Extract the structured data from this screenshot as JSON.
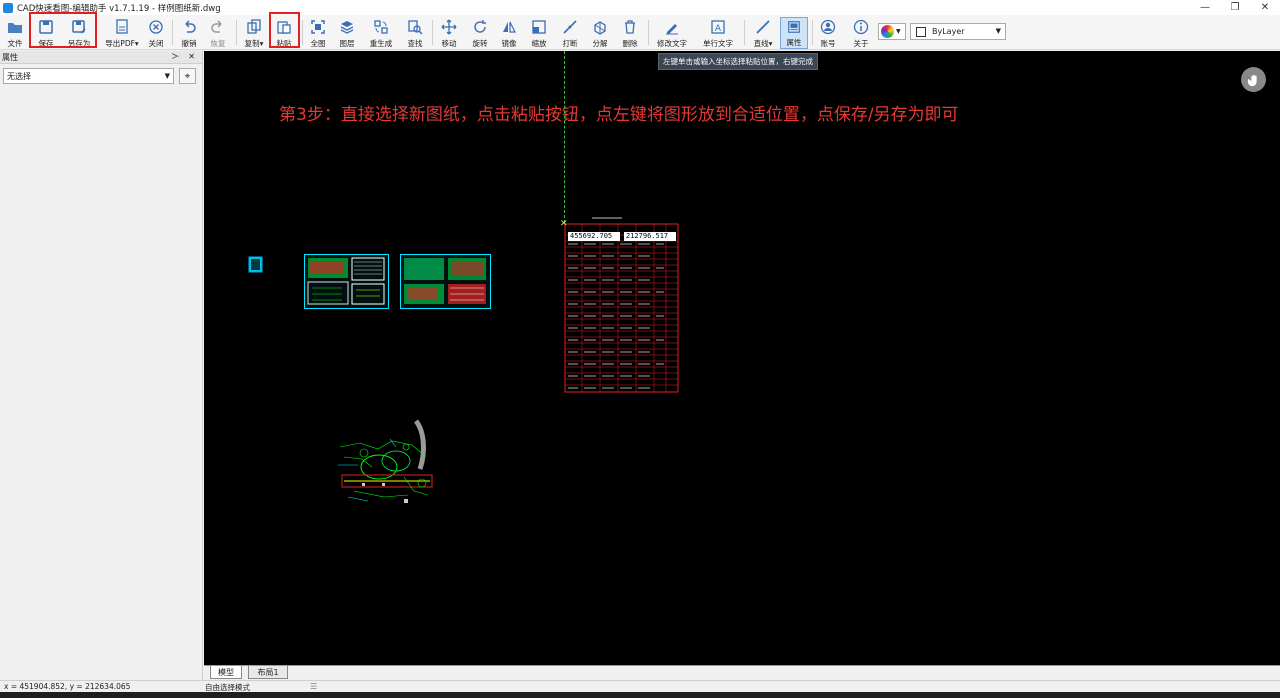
{
  "window": {
    "title": "CAD快速看图-编辑助手 v1.7.1.19 - 样例图纸新.dwg",
    "controls": [
      "—",
      "❐",
      "✕"
    ]
  },
  "toolbar": {
    "file": "文件",
    "save": "保存",
    "save_as": "另存为",
    "export_pdf": "导出PDF▾",
    "close": "关闭",
    "undo": "撤销",
    "redo": "恢复",
    "copy": "复制▾",
    "paste": "粘贴",
    "full_view": "全图",
    "layers": "图层",
    "regen": "重生成",
    "find": "查找",
    "move": "移动",
    "rotate": "旋转",
    "mirror": "镜像",
    "scale": "缩放",
    "break": "打断",
    "explode": "分解",
    "delete": "删除",
    "edit_text": "修改文字",
    "single_text": "单行文字",
    "line": "直线▾",
    "properties": "属性",
    "account": "账号",
    "about": "关于",
    "layer_value": "ByLayer"
  },
  "panel": {
    "title": "属性",
    "controls": "ᑁ ✕",
    "selection": "无选择"
  },
  "canvas": {
    "tooltip": "左键单击或输入坐标选择粘贴位置，右键完成",
    "instruction": "第3步：直接选择新图纸，点击粘贴按钮，点左键将图形放到合适位置，点保存/另存为即可",
    "readout_x": "455692.705",
    "readout_y": "212796.517"
  },
  "tabs": {
    "model": "模型",
    "layout1": "布局1"
  },
  "status": {
    "coords": "x = 451904.852,  y = 212634.065",
    "mode": "自由选择模式"
  },
  "colors": {
    "accent": "#1e88e5",
    "highlight_box": "#e02020",
    "instruction_text": "#e53935",
    "canvas_bg": "#000000"
  }
}
